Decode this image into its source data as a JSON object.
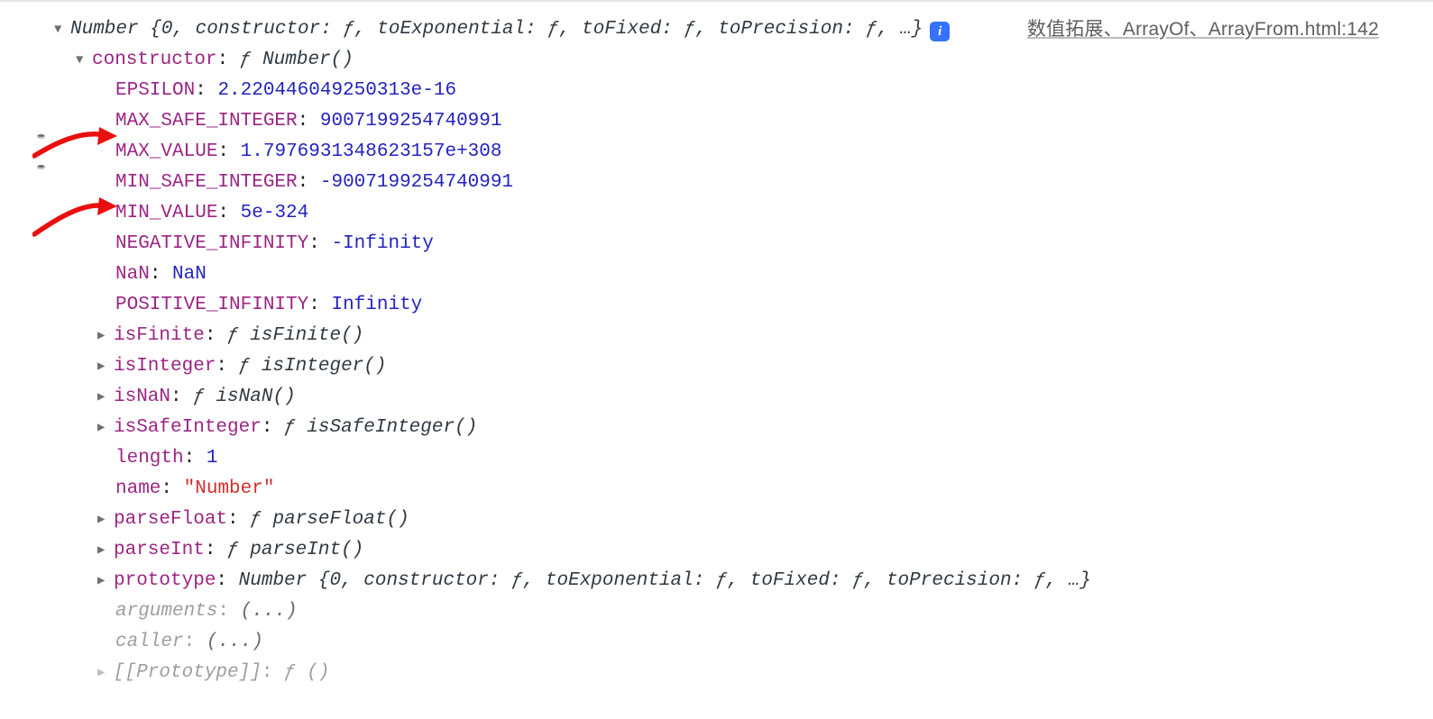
{
  "source": {
    "text": "数值拓展、ArrayOf、ArrayFrom.html:142"
  },
  "info_badge": "i",
  "summaries": {
    "number_header": "Number {0, constructor: ƒ, toExponential: ƒ, toFixed: ƒ, toPrecision: ƒ, …}",
    "number_proto_inline": "Number {0, constructor: ƒ, toExponential: ƒ, toFixed: ƒ, toPrecision: ƒ, …}"
  },
  "constructor_header": {
    "key": "constructor",
    "fsym": "ƒ",
    "sig": "Number()"
  },
  "consts": {
    "EPSILON": {
      "value": "2.220446049250313e-16"
    },
    "MAX_SAFE_INTEGER": {
      "value": "9007199254740991"
    },
    "MAX_VALUE": {
      "value": "1.7976931348623157e+308"
    },
    "MIN_SAFE_INTEGER": {
      "value": "-9007199254740991"
    },
    "MIN_VALUE": {
      "value": "5e-324"
    },
    "NEGATIVE_INFINITY": {
      "value": "-Infinity"
    },
    "NaN": {
      "value": "NaN"
    },
    "POSITIVE_INFINITY": {
      "value": "Infinity"
    }
  },
  "keys": {
    "EPSILON": "EPSILON",
    "MAX_SAFE_INTEGER": "MAX_SAFE_INTEGER",
    "MAX_VALUE": "MAX_VALUE",
    "MIN_SAFE_INTEGER": "MIN_SAFE_INTEGER",
    "MIN_VALUE": "MIN_VALUE",
    "NEGATIVE_INFINITY": "NEGATIVE_INFINITY",
    "NaN": "NaN",
    "POSITIVE_INFINITY": "POSITIVE_INFINITY",
    "length": "length",
    "name": "name",
    "prototype": "prototype",
    "arguments": "arguments",
    "caller": "caller",
    "Prototype_internal": "[[Prototype]]"
  },
  "funcs": {
    "isFinite": {
      "key": "isFinite",
      "fsym": "ƒ",
      "sig": "isFinite()"
    },
    "isInteger": {
      "key": "isInteger",
      "fsym": "ƒ",
      "sig": "isInteger()"
    },
    "isNaN": {
      "key": "isNaN",
      "fsym": "ƒ",
      "sig": "isNaN()"
    },
    "isSafeInteger": {
      "key": "isSafeInteger",
      "fsym": "ƒ",
      "sig": "isSafeInteger()"
    },
    "parseFloat": {
      "key": "parseFloat",
      "fsym": "ƒ",
      "sig": "parseFloat()"
    },
    "parseInt": {
      "key": "parseInt",
      "fsym": "ƒ",
      "sig": "parseInt()"
    }
  },
  "simple": {
    "length": "1",
    "name": "\"Number\"",
    "arguments": "(...)",
    "caller": "(...)",
    "protoInternal_fsym": "ƒ",
    "protoInternal_sig": "()"
  },
  "glyphs": {
    "down": "▼",
    "right": "▶"
  }
}
